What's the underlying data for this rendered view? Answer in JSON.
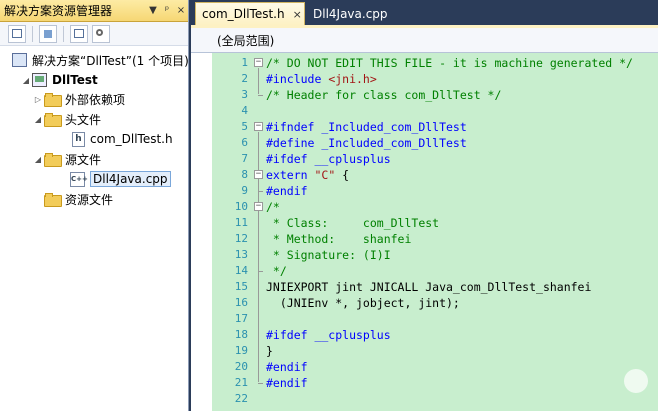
{
  "solution_explorer": {
    "title": "解决方案资源管理器",
    "title_buttons": [
      "▼",
      "ᵖ",
      "×"
    ],
    "tree": {
      "solution": "解决方案“DllTest”(1 个项目)",
      "project": "DllTest",
      "external_deps": "外部依赖项",
      "headers": "头文件",
      "header_file": "com_DllTest.h",
      "sources": "源文件",
      "source_file": "Dll4Java.cpp",
      "resources": "资源文件"
    }
  },
  "editor": {
    "tabs": [
      {
        "label": "com_DllTest.h",
        "close": "×"
      },
      {
        "label": "Dll4Java.cpp"
      }
    ],
    "scope": "(全局范围)",
    "lines": [
      "/* DO NOT EDIT THIS FILE - it is machine generated */",
      "#include <jni.h>",
      "/* Header for class com_DllTest */",
      "",
      "#ifndef _Included_com_DllTest",
      "#define _Included_com_DllTest",
      "#ifdef __cplusplus",
      "extern \"C\" {",
      "#endif",
      "/*",
      " * Class:     com_DllTest",
      " * Method:    shanfei",
      " * Signature: (I)I",
      " */",
      "JNIEXPORT jint JNICALL Java_com_DllTest_shanfei",
      "  (JNIEnv *, jobject, jint);",
      "",
      "#ifdef __cplusplus",
      "}",
      "#endif",
      "#endif",
      ""
    ]
  },
  "colors": {
    "code_background": "#c8eece",
    "line_number": "#2b91af",
    "comment": "#008000",
    "keyword": "#0000ff"
  }
}
